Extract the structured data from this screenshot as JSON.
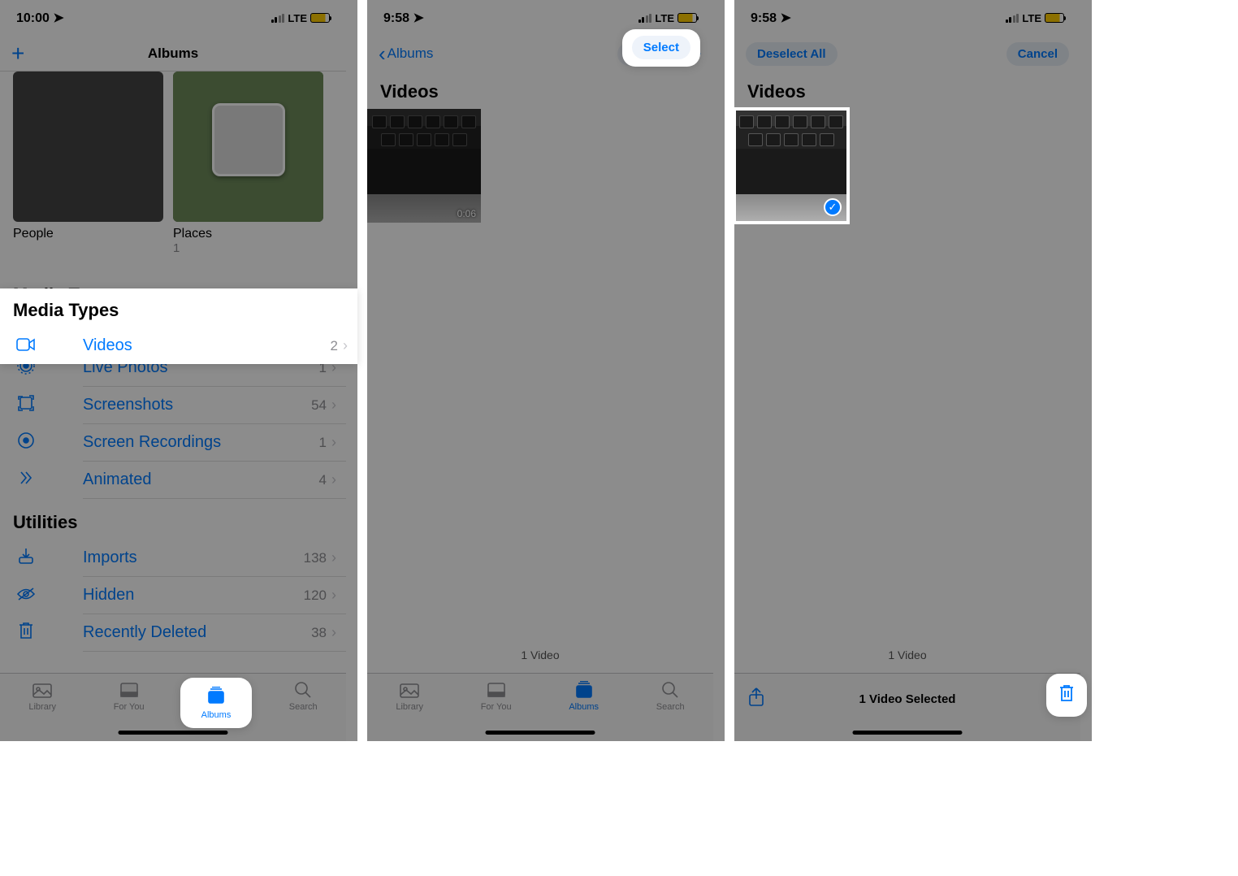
{
  "status": {
    "time1": "10:00",
    "time2": "9:58",
    "time3": "9:58",
    "net": "LTE"
  },
  "panel1": {
    "nav_title": "Albums",
    "albums": [
      {
        "label": "People",
        "count": ""
      },
      {
        "label": "Places",
        "count": "1"
      }
    ],
    "section_media": "Media Types",
    "media": [
      {
        "icon": "video",
        "label": "Videos",
        "count": "2"
      },
      {
        "icon": "live",
        "label": "Live Photos",
        "count": "1"
      },
      {
        "icon": "screenshot",
        "label": "Screenshots",
        "count": "54"
      },
      {
        "icon": "record",
        "label": "Screen Recordings",
        "count": "1"
      },
      {
        "icon": "animated",
        "label": "Animated",
        "count": "4"
      }
    ],
    "section_util": "Utilities",
    "util": [
      {
        "icon": "import",
        "label": "Imports",
        "count": "138"
      },
      {
        "icon": "hidden",
        "label": "Hidden",
        "count": "120"
      },
      {
        "icon": "trash",
        "label": "Recently Deleted",
        "count": "38"
      }
    ]
  },
  "tabs": [
    {
      "label": "Library"
    },
    {
      "label": "For You"
    },
    {
      "label": "Albums"
    },
    {
      "label": "Search"
    }
  ],
  "panel2": {
    "back": "Albums",
    "select": "Select",
    "title": "Videos",
    "duration": "0:06",
    "footer": "1 Video"
  },
  "panel3": {
    "deselect": "Deselect All",
    "cancel": "Cancel",
    "title": "Videos",
    "footer": "1 Video",
    "selected": "1 Video Selected"
  }
}
